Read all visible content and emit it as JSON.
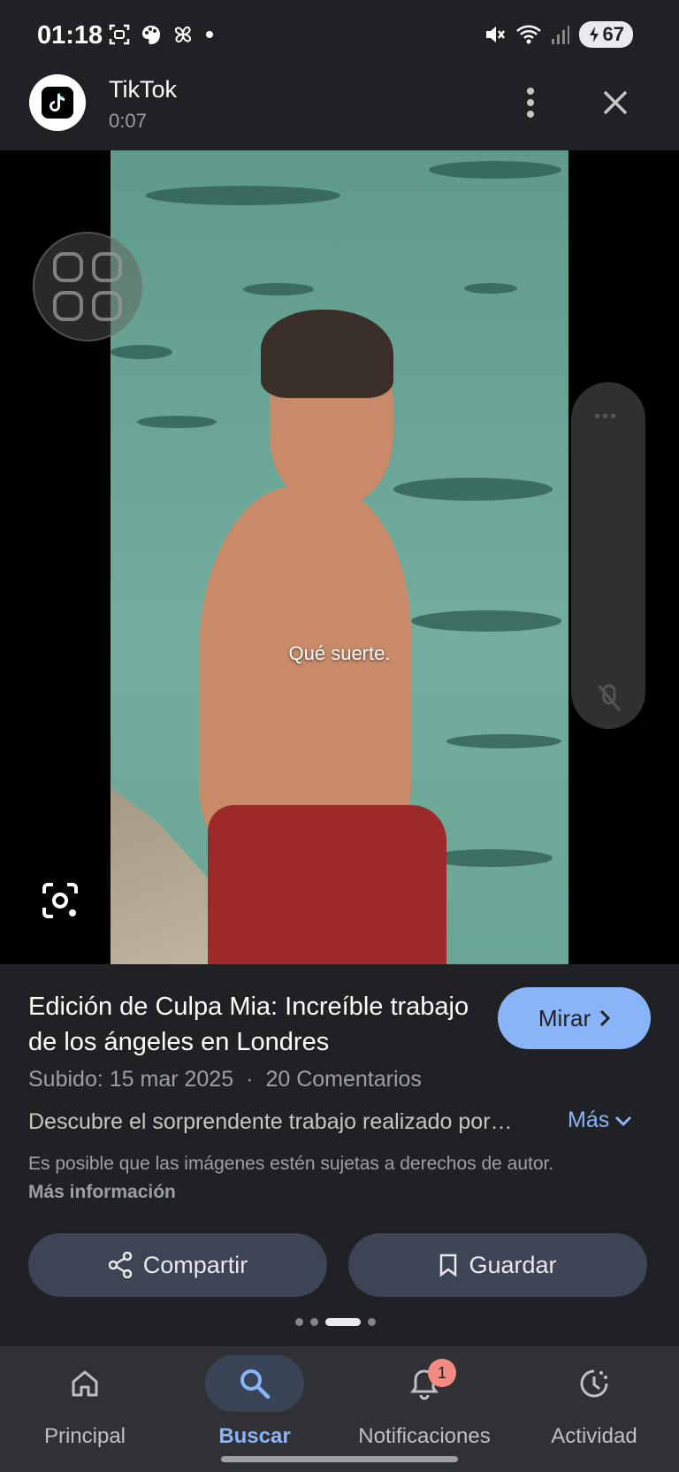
{
  "status_bar": {
    "time": "01:18",
    "battery": "67",
    "icons": [
      "screenshot-icon",
      "palette-icon",
      "pinwheel-icon",
      "dot-icon",
      "mute-icon",
      "wifi-icon",
      "signal-icon",
      "battery-icon"
    ]
  },
  "header": {
    "app_name": "TikTok",
    "duration": "0:07"
  },
  "video": {
    "subtitle": "Qué suerte."
  },
  "info": {
    "title": "Edición de Culpa Mia: Increíble trabajo de los ángeles en Londres",
    "watch_label": "Mirar",
    "uploaded": "Subido: 15 mar 2025",
    "separator": "·",
    "comments": "20 Comentarios",
    "description": "Descubre el sorprendente trabajo realizado por…",
    "more_label": "Más",
    "notice": "Es posible que las imágenes estén sujetas a derechos de autor.",
    "notice_link": "Más información",
    "share_label": "Compartir",
    "save_label": "Guardar"
  },
  "nav": {
    "home": "Principal",
    "search": "Buscar",
    "notifications": "Notificaciones",
    "notifications_badge": "1",
    "activity": "Actividad"
  },
  "colors": {
    "background": "#202124",
    "accent": "#8ab4f8",
    "button": "#3c4455",
    "badge": "#f28b82"
  }
}
